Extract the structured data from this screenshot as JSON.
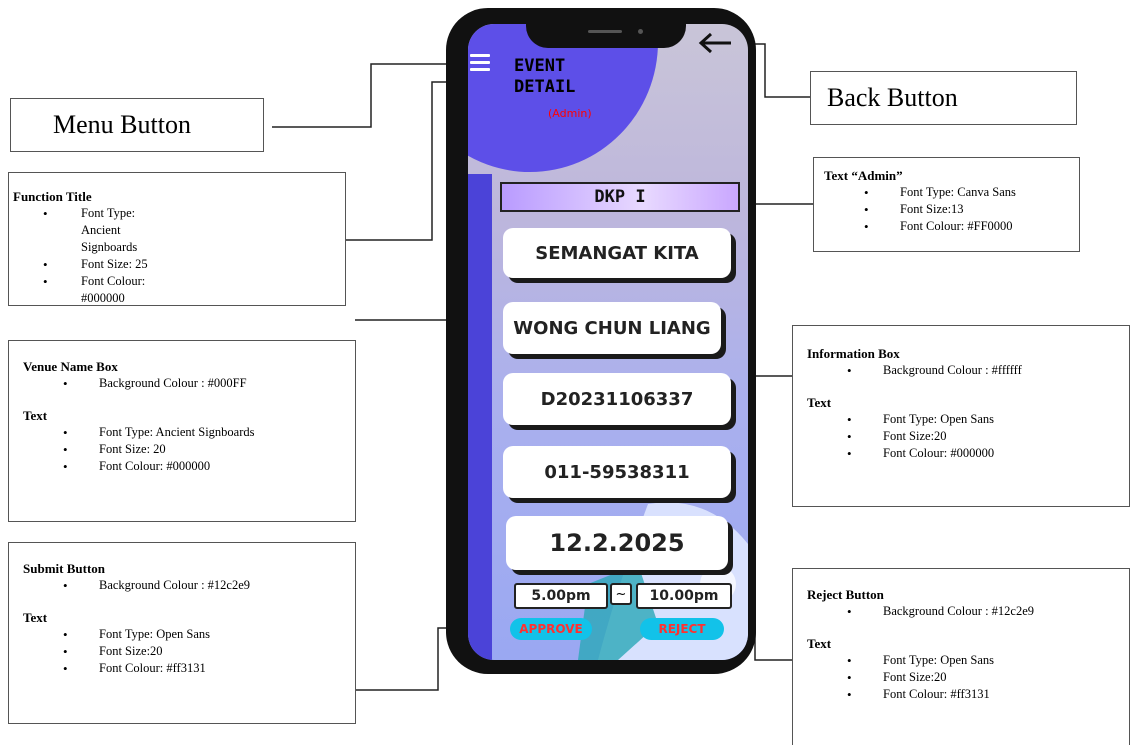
{
  "callouts": {
    "menu_button": {
      "label": "Menu Button"
    },
    "back_button": {
      "label": "Back Button"
    },
    "function_title": {
      "heading": "Function Title",
      "items": [
        "Font Type: Ancient Signboards",
        "Font Size: 25",
        "Font Colour: #000000"
      ]
    },
    "text_admin": {
      "heading": "Text “Admin”",
      "items": [
        "Font Type: Canva Sans",
        "Font Size:13",
        "Font Colour: #FF0000"
      ]
    },
    "venue_name_box": {
      "heading": "Venue Name Box",
      "items": [
        "Background Colour : #000FF"
      ],
      "text_heading": "Text",
      "text_items": [
        "Font Type: Ancient Signboards",
        "Font Size: 20",
        "Font Colour: #000000"
      ]
    },
    "information_box": {
      "heading": "Information Box",
      "items": [
        "Background Colour : #ffffff"
      ],
      "text_heading": "Text",
      "text_items": [
        "Font Type: Open Sans",
        "Font Size:20",
        "Font Colour: #000000"
      ]
    },
    "submit_button": {
      "heading": "Submit Button",
      "items": [
        "Background Colour : #12c2e9"
      ],
      "text_heading": "Text",
      "text_items": [
        "Font Type: Open Sans",
        "Font Size:20",
        "Font Colour: #ff3131"
      ]
    },
    "reject_button": {
      "heading": "Reject Button",
      "items": [
        "Background Colour : #12c2e9"
      ],
      "text_heading": "Text",
      "text_items": [
        "Font Type: Open Sans",
        "Font Size:20",
        "Font Colour: #ff3131"
      ]
    }
  },
  "phone": {
    "title_line1": "EVENT",
    "title_line2": "DETAIL",
    "admin_label": "(Admin)",
    "venue": "DKP I",
    "info_boxes": [
      "SEMANGAT KITA",
      "WONG CHUN LIANG",
      "D20231106337",
      "011-59538311",
      "12.2.2025"
    ],
    "time_start": "5.00pm",
    "time_separator": "~",
    "time_end": "10.00pm",
    "approve_label": "APPROVE",
    "reject_label": "REJECT",
    "menu_icon": "hamburger-menu-icon",
    "back_icon": "back-arrow-icon"
  },
  "colors": {
    "venue_box": "#c9a7ff",
    "button_bg": "#12c2e9",
    "button_text": "#ff3131",
    "admin_text": "#ff0000",
    "blob": "#5d4fe8"
  }
}
